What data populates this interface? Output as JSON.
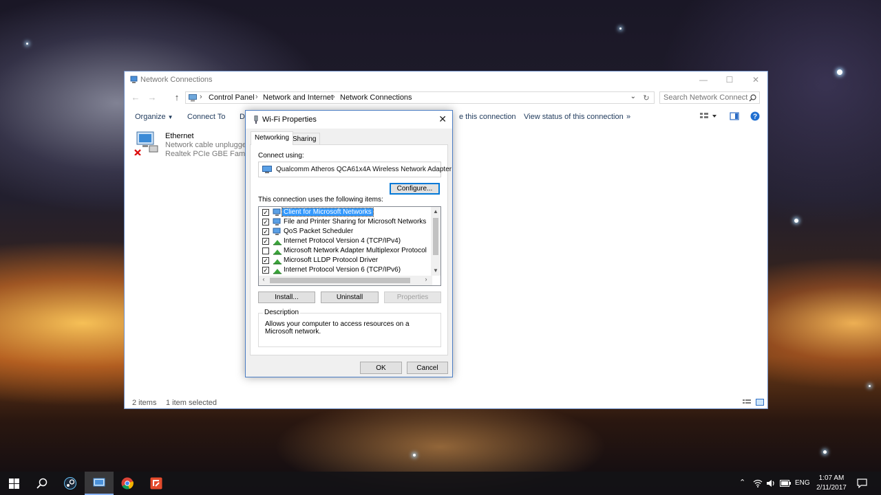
{
  "explorer": {
    "title": "Network Connections",
    "breadcrumbs": [
      "Control Panel",
      "Network and Internet",
      "Network Connections"
    ],
    "search_placeholder": "Search Network Connecti...",
    "commands": {
      "organize": "Organize",
      "connect_to": "Connect To",
      "truncated": "Di",
      "rename": "e this connection",
      "view_status": "View status of this connection",
      "more": "»"
    },
    "item": {
      "name": "Ethernet",
      "status": "Network cable unplugged",
      "device": "Realtek PCIe GBE Family C"
    },
    "status": {
      "count": "2 items",
      "selected": "1 item selected"
    }
  },
  "dialog": {
    "title": "Wi-Fi Properties",
    "tabs": [
      "Networking",
      "Sharing"
    ],
    "connect_using_label": "Connect using:",
    "adapter_name": "Qualcomm Atheros QCA61x4A Wireless Network Adapter",
    "configure_label": "Configure...",
    "items_label": "This connection uses the following items:",
    "items": [
      {
        "label": "Client for Microsoft Networks",
        "checked": true,
        "selected": true,
        "icon": "network-client-icon"
      },
      {
        "label": "File and Printer Sharing for Microsoft Networks",
        "checked": true,
        "selected": false,
        "icon": "network-service-icon"
      },
      {
        "label": "QoS Packet Scheduler",
        "checked": true,
        "selected": false,
        "icon": "network-service-icon"
      },
      {
        "label": "Internet Protocol Version 4 (TCP/IPv4)",
        "checked": true,
        "selected": false,
        "icon": "protocol-icon"
      },
      {
        "label": "Microsoft Network Adapter Multiplexor Protocol",
        "checked": false,
        "selected": false,
        "icon": "protocol-icon"
      },
      {
        "label": "Microsoft LLDP Protocol Driver",
        "checked": true,
        "selected": false,
        "icon": "protocol-icon"
      },
      {
        "label": "Internet Protocol Version 6 (TCP/IPv6)",
        "checked": true,
        "selected": false,
        "icon": "protocol-icon"
      }
    ],
    "install_label": "Install...",
    "uninstall_label": "Uninstall",
    "properties_label": "Properties",
    "description_legend": "Description",
    "description_text": "Allows your computer to access resources on a Microsoft network.",
    "ok_label": "OK",
    "cancel_label": "Cancel"
  },
  "taskbar": {
    "apps": [
      "windows-start-icon",
      "search-icon",
      "steam-icon",
      "network-connections-icon",
      "chrome-icon",
      "app-icon"
    ],
    "language": "ENG",
    "time": "1:07 AM",
    "date": "2/11/2017"
  },
  "colors": {
    "accent": "#0078d7",
    "selection": "#3399ff",
    "link": "#1e395b"
  }
}
